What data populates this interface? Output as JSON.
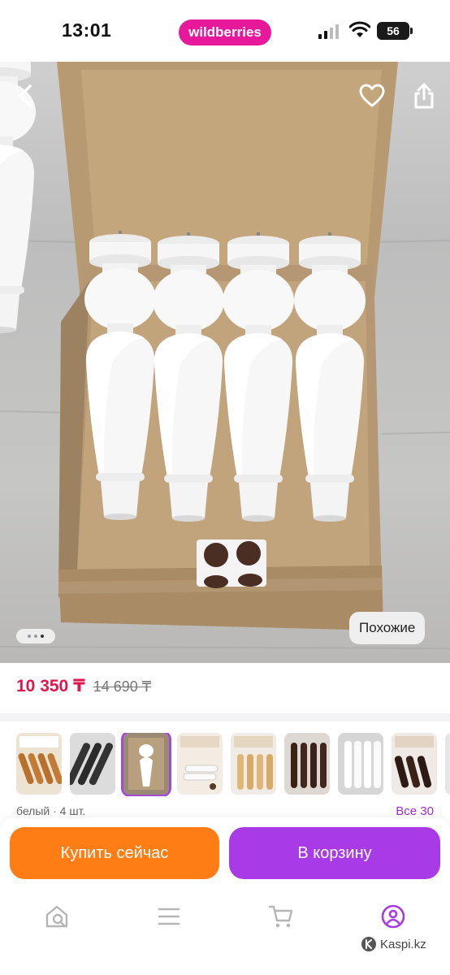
{
  "status_bar": {
    "time": "13:01",
    "brand": "wildberries",
    "battery": "56",
    "icons": [
      "signal-icon",
      "wifi-icon",
      "battery-icon"
    ]
  },
  "hero": {
    "similar_label": "Похожие",
    "gallery_dots": 3,
    "gallery_active_index": 2,
    "icons": [
      "back-icon",
      "heart-icon",
      "share-icon"
    ]
  },
  "price": {
    "current": "10 350 ₸",
    "old": "14 690 ₸"
  },
  "variants": {
    "caption": "белый · 4 шт.",
    "all_label": "Все 30",
    "selected_index": 2,
    "count_visible": 8
  },
  "actions": {
    "buy_now": "Купить сейчас",
    "add_to_cart": "В корзину"
  },
  "bottom_nav": {
    "items": [
      "home-search-icon",
      "catalog-icon",
      "cart-icon",
      "profile-icon"
    ],
    "active_index": 3
  },
  "watermark": {
    "text": "Kaspi.kz"
  },
  "colors": {
    "brand": "#e8189b",
    "price": "#e0164c",
    "buy": "#ff7d14",
    "cart": "#a93be6",
    "accent": "#a02fcf"
  }
}
